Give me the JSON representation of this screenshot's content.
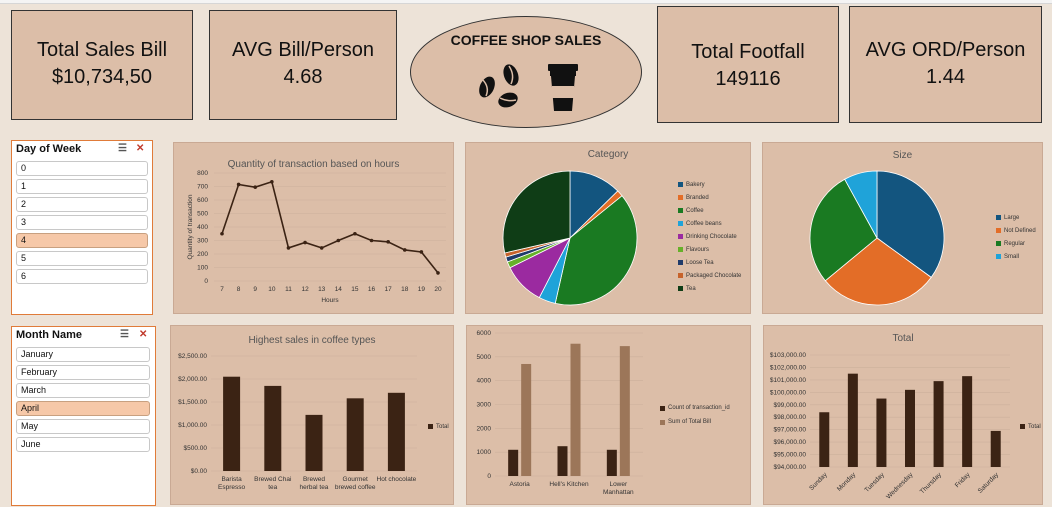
{
  "kpis": {
    "total_sales": {
      "title": "Total Sales Bill",
      "value": "$10,734,50"
    },
    "avg_bill": {
      "title": "AVG Bill/Person",
      "value": "4.68"
    },
    "total_footfall": {
      "title": "Total Footfall",
      "value": "149116"
    },
    "avg_ord": {
      "title": "AVG ORD/Person",
      "value": "1.44"
    }
  },
  "logo": {
    "title": "COFFEE SHOP SALES"
  },
  "slicer_day": {
    "title": "Day of Week",
    "items": [
      "0",
      "1",
      "2",
      "3",
      "4",
      "5",
      "6"
    ],
    "selected": "4"
  },
  "slicer_month": {
    "title": "Month Name",
    "items": [
      "January",
      "February",
      "March",
      "April",
      "May",
      "June"
    ],
    "selected": "April"
  },
  "colors": {
    "panel": "#dcbea8",
    "bar_dark": "#3b2314",
    "bar_light": "#9c7659",
    "slicer_selected": "#f6c8a8"
  },
  "chart_data": [
    {
      "type": "line",
      "title": "Quantity of transaction based on hours",
      "xlabel": "Hours",
      "ylabel": "Quantity of transaction",
      "x": [
        "7",
        "8",
        "9",
        "10",
        "11",
        "12",
        "13",
        "14",
        "15",
        "16",
        "17",
        "18",
        "19",
        "20"
      ],
      "values": [
        350,
        715,
        695,
        735,
        245,
        285,
        245,
        300,
        350,
        300,
        290,
        230,
        215,
        60
      ],
      "ylim": [
        0,
        800
      ],
      "yticks": [
        "0",
        "100",
        "200",
        "300",
        "400",
        "500",
        "600",
        "700",
        "800"
      ]
    },
    {
      "type": "pie",
      "title": "Category",
      "categories": [
        "Bakery",
        "Branded",
        "Coffee",
        "Coffee beans",
        "Drinking Chocolate",
        "Flavours",
        "Loose Tea",
        "Packaged Chocolate",
        "Tea"
      ],
      "values": [
        12.5,
        1.5,
        39,
        4,
        10,
        1.5,
        1.2,
        1,
        28.3
      ],
      "colors": [
        "#13557f",
        "#e36d27",
        "#1a7a22",
        "#1fa3d9",
        "#9b2aa0",
        "#66b02a",
        "#1f3b6a",
        "#c7632b",
        "#0f3d16"
      ]
    },
    {
      "type": "pie",
      "title": "Size",
      "categories": [
        "Large",
        "Not Defined",
        "Regular",
        "Small"
      ],
      "values": [
        35,
        29,
        28,
        8
      ],
      "colors": [
        "#13557f",
        "#e36d27",
        "#1a7a22",
        "#1fa3d9"
      ]
    },
    {
      "type": "bar",
      "title": "Highest sales in coffee types",
      "categories": [
        "Barista Espresso",
        "Brewed Chai tea",
        "Brewed herbal tea",
        "Gourmet brewed coffee",
        "Hot chocolate"
      ],
      "values": [
        2050,
        1850,
        1220,
        1580,
        1700
      ],
      "ylim": [
        0,
        2500
      ],
      "yticks": [
        "$0.00",
        "$500.00",
        "$1,000.00",
        "$1,500.00",
        "$2,000.00",
        "$2,500.00"
      ],
      "legend": "Total"
    },
    {
      "type": "bar",
      "title": "",
      "categories": [
        "Astoria",
        "Hell's Kitchen",
        "Lower Manhattan"
      ],
      "series": [
        {
          "name": "Count of transaction_id",
          "values": [
            1100,
            1250,
            1100
          ],
          "color": "#3b2314"
        },
        {
          "name": "Sum of Total Bill",
          "values": [
            4700,
            5550,
            5450
          ],
          "color": "#9c7659"
        }
      ],
      "ylim": [
        0,
        6000
      ],
      "yticks": [
        "0",
        "1000",
        "2000",
        "3000",
        "4000",
        "5000",
        "6000"
      ]
    },
    {
      "type": "bar",
      "title": "Total",
      "categories": [
        "Sunday",
        "Monday",
        "Tuesday",
        "Wednesday",
        "Thursday",
        "Friday",
        "Saturday"
      ],
      "values": [
        98400,
        101500,
        99500,
        100200,
        100900,
        101300,
        96900
      ],
      "ylim": [
        94000,
        103000
      ],
      "yticks": [
        "$94,000.00",
        "$95,000.00",
        "$96,000.00",
        "$97,000.00",
        "$98,000.00",
        "$99,000.00",
        "$100,000.00",
        "$101,000.00",
        "$102,000.00",
        "$103,000.00"
      ],
      "legend": "Total"
    }
  ]
}
